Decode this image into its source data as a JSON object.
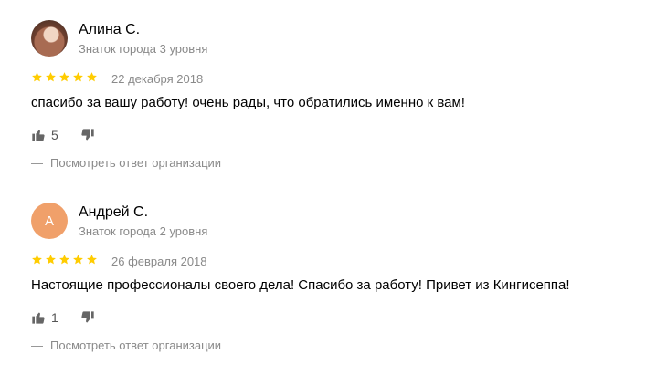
{
  "reviews": [
    {
      "author": "Алина С.",
      "level": "Знаток города 3 уровня",
      "rating": 5,
      "date": "22 декабря 2018",
      "text": "спасибо за вашу работу! очень рады, что обратились именно к вам!",
      "likes": "5",
      "org_answer_dash": "—",
      "org_answer_label": "Посмотреть ответ организации"
    },
    {
      "author": "Андрей С.",
      "avatar_letter": "А",
      "avatar_color": "#f0a06a",
      "level": "Знаток города 2 уровня",
      "rating": 5,
      "date": "26 февраля 2018",
      "text": "Настоящие профессионалы своего дела! Спасибо за работу! Привет из Кингисеппа!",
      "likes": "1",
      "org_answer_dash": "—",
      "org_answer_label": "Посмотреть ответ организации"
    }
  ],
  "colors": {
    "star": "#fc0",
    "secondary_text": "#8a8a8a",
    "icon": "#555555"
  }
}
